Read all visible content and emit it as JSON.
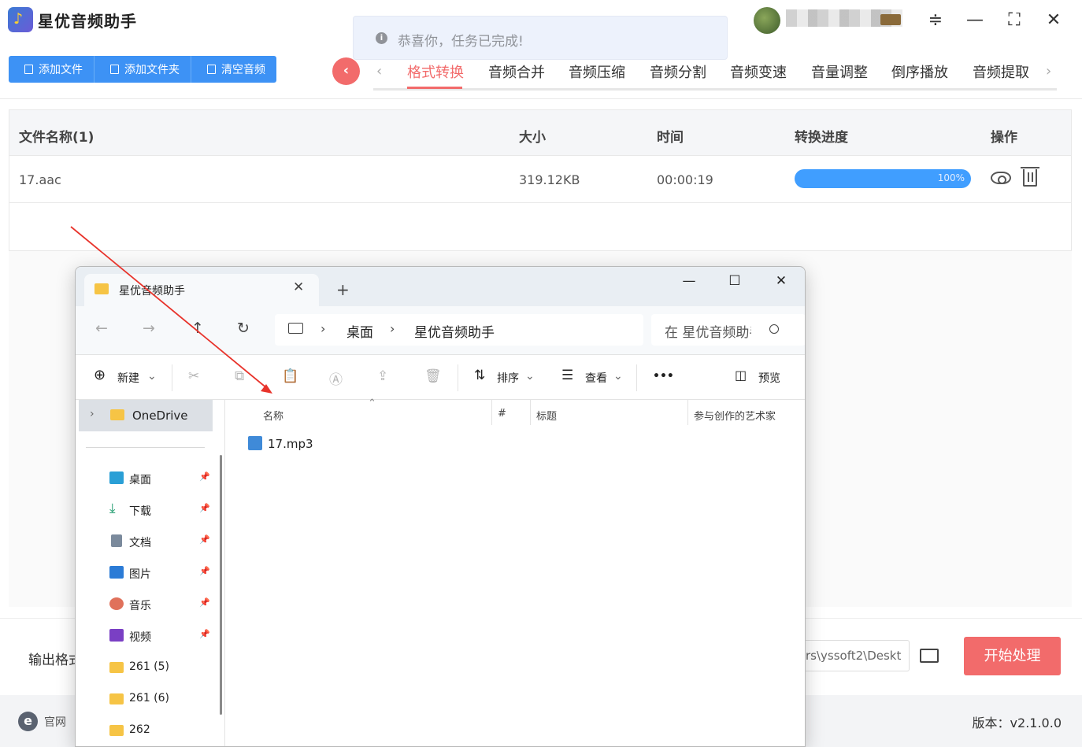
{
  "app": {
    "title": "星优音频助手",
    "toast": "恭喜你，任务已完成!",
    "toolbar": {
      "add_file": "添加文件",
      "add_folder": "添加文件夹",
      "clear": "清空音频"
    },
    "tabs": [
      "格式转换",
      "音频合并",
      "音频压缩",
      "音频分割",
      "音频变速",
      "音量调整",
      "倒序播放",
      "音频提取"
    ],
    "active_tab": "格式转换",
    "table": {
      "headers": {
        "name": "文件名称(1)",
        "size": "大小",
        "time": "时间",
        "progress": "转换进度",
        "actions": "操作"
      },
      "rows": [
        {
          "name": "17.aac",
          "size": "319.12KB",
          "time": "00:00:19",
          "progress_label": "100%",
          "progress_value": 1.0
        }
      ]
    },
    "output": {
      "label": "输出格式",
      "path": "rs\\yssoft2\\Deskt"
    },
    "start_button": "开始处理",
    "footer": {
      "site": "官网",
      "version": "版本：v2.1.0.0"
    },
    "colors": {
      "accent": "#f26b6b",
      "primary": "#3d92f5",
      "progress": "#409eff"
    }
  },
  "explorer": {
    "tab_title": "星优音频助手",
    "breadcrumb": [
      "桌面",
      "星优音频助手"
    ],
    "search_placeholder": "在 星优音频助手 中搜索",
    "commands": {
      "new": "新建",
      "sort": "排序",
      "view": "查看",
      "more": "•••",
      "preview": "预览"
    },
    "nav_top": "OneDrive",
    "nav_items": [
      {
        "label": "桌面",
        "pinned": true,
        "icon": "desktop-icon"
      },
      {
        "label": "下载",
        "pinned": true,
        "icon": "download-icon"
      },
      {
        "label": "文档",
        "pinned": true,
        "icon": "document-icon"
      },
      {
        "label": "图片",
        "pinned": true,
        "icon": "pictures-icon"
      },
      {
        "label": "音乐",
        "pinned": true,
        "icon": "music-icon"
      },
      {
        "label": "视频",
        "pinned": true,
        "icon": "video-icon"
      },
      {
        "label": "261 (5)",
        "pinned": false,
        "icon": "folder-icon"
      },
      {
        "label": "261 (6)",
        "pinned": false,
        "icon": "folder-icon"
      },
      {
        "label": "262",
        "pinned": false,
        "icon": "folder-icon"
      }
    ],
    "columns": {
      "name": "名称",
      "number": "#",
      "title": "标题",
      "artist": "参与创作的艺术家"
    },
    "files": [
      {
        "name": "17.mp3",
        "icon": "audio-file-icon"
      }
    ]
  }
}
